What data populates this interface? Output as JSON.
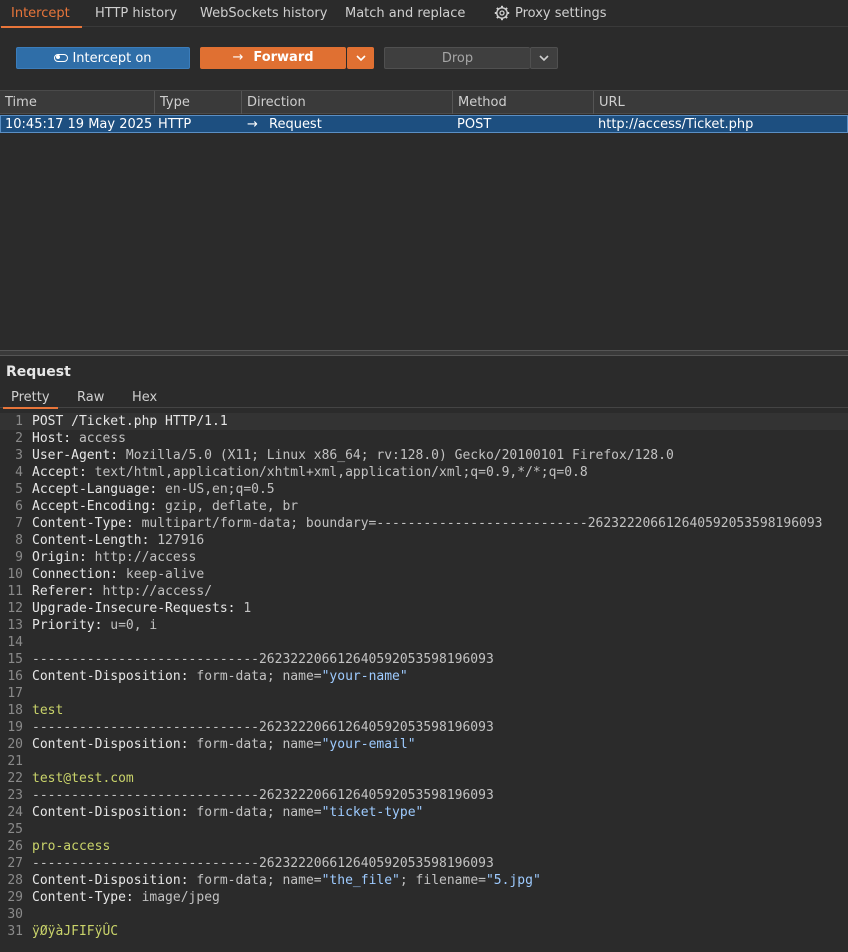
{
  "tabs": {
    "intercept": "Intercept",
    "http_history": "HTTP history",
    "websockets_history": "WebSockets history",
    "match_replace": "Match and replace",
    "proxy_settings": "Proxy settings"
  },
  "toolbar": {
    "intercept_label": "Intercept on",
    "forward_label": "Forward",
    "forward_arrow": "→",
    "drop_label": "Drop",
    "dropdown_glyph": "⌄"
  },
  "table": {
    "columns": [
      "Time",
      "Type",
      "Direction",
      "Method",
      "URL"
    ],
    "row": {
      "time": "10:45:17 19 May 2025",
      "type": "HTTP",
      "direction_arrow": "→",
      "direction": "Request",
      "method": "POST",
      "url": "http://access/Ticket.php"
    }
  },
  "request": {
    "title": "Request",
    "subtabs": [
      "Pretty",
      "Raw",
      "Hex"
    ],
    "lines": [
      {
        "n": "1",
        "k": "POST /Ticket.php HTTP/1.1",
        "v": "",
        "kind": "plain"
      },
      {
        "n": "2",
        "k": "Host:",
        "v": " access",
        "kind": "header"
      },
      {
        "n": "3",
        "k": "User-Agent:",
        "v": " Mozilla/5.0 (X11; Linux x86_64; rv:128.0) Gecko/20100101 Firefox/128.0",
        "kind": "header"
      },
      {
        "n": "4",
        "k": "Accept:",
        "v": " text/html,application/xhtml+xml,application/xml;q=0.9,*/*;q=0.8",
        "kind": "header"
      },
      {
        "n": "5",
        "k": "Accept-Language:",
        "v": " en-US,en;q=0.5",
        "kind": "header"
      },
      {
        "n": "6",
        "k": "Accept-Encoding:",
        "v": " gzip, deflate, br",
        "kind": "header"
      },
      {
        "n": "7",
        "k": "Content-Type:",
        "v": " multipart/form-data; boundary=---------------------------262322206612640592053598196093",
        "kind": "header"
      },
      {
        "n": "8",
        "k": "Content-Length:",
        "v": " 127916",
        "kind": "header"
      },
      {
        "n": "9",
        "k": "Origin:",
        "v": " http://access",
        "kind": "header"
      },
      {
        "n": "10",
        "k": "Connection:",
        "v": " keep-alive",
        "kind": "header"
      },
      {
        "n": "11",
        "k": "Referer:",
        "v": " http://access/",
        "kind": "header"
      },
      {
        "n": "12",
        "k": "Upgrade-Insecure-Requests:",
        "v": " 1",
        "kind": "header"
      },
      {
        "n": "13",
        "k": "Priority:",
        "v": " u=0, i",
        "kind": "header"
      },
      {
        "n": "14",
        "k": "",
        "v": "",
        "kind": "plain"
      },
      {
        "n": "15",
        "k": "-----------------------------262322206612640592053598196093",
        "v": "",
        "kind": "boundary"
      },
      {
        "n": "16",
        "k": "Content-Disposition:",
        "v": " form-data; name=",
        "s": "\"your-name\"",
        "kind": "disp"
      },
      {
        "n": "17",
        "k": "",
        "v": "",
        "kind": "plain"
      },
      {
        "n": "18",
        "k": "test",
        "v": "",
        "kind": "value"
      },
      {
        "n": "19",
        "k": "-----------------------------262322206612640592053598196093",
        "v": "",
        "kind": "boundary"
      },
      {
        "n": "20",
        "k": "Content-Disposition:",
        "v": " form-data; name=",
        "s": "\"your-email\"",
        "kind": "disp"
      },
      {
        "n": "21",
        "k": "",
        "v": "",
        "kind": "plain"
      },
      {
        "n": "22",
        "k": "test@test.com",
        "v": "",
        "kind": "value"
      },
      {
        "n": "23",
        "k": "-----------------------------262322206612640592053598196093",
        "v": "",
        "kind": "boundary"
      },
      {
        "n": "24",
        "k": "Content-Disposition:",
        "v": " form-data; name=",
        "s": "\"ticket-type\"",
        "kind": "disp"
      },
      {
        "n": "25",
        "k": "",
        "v": "",
        "kind": "plain"
      },
      {
        "n": "26",
        "k": "pro-access",
        "v": "",
        "kind": "value"
      },
      {
        "n": "27",
        "k": "-----------------------------262322206612640592053598196093",
        "v": "",
        "kind": "boundary"
      },
      {
        "n": "28",
        "k": "Content-Disposition:",
        "v": " form-data; name=",
        "s": "\"the_file\"",
        "v2": "; filename=",
        "s2": "\"5.jpg\"",
        "kind": "disp2"
      },
      {
        "n": "29",
        "k": "Content-Type:",
        "v": " image/jpeg",
        "kind": "header"
      },
      {
        "n": "30",
        "k": "",
        "v": "",
        "kind": "plain"
      },
      {
        "n": "31",
        "k": "ÿØÿàJFIFÿÛC",
        "v": "",
        "kind": "value"
      }
    ]
  },
  "colors": {
    "accent": "#e8753a",
    "intercept_blue": "#2f6ea8",
    "selected_row": "#1d4f80",
    "string": "#9ecbff",
    "body_value": "#c9d36a"
  }
}
